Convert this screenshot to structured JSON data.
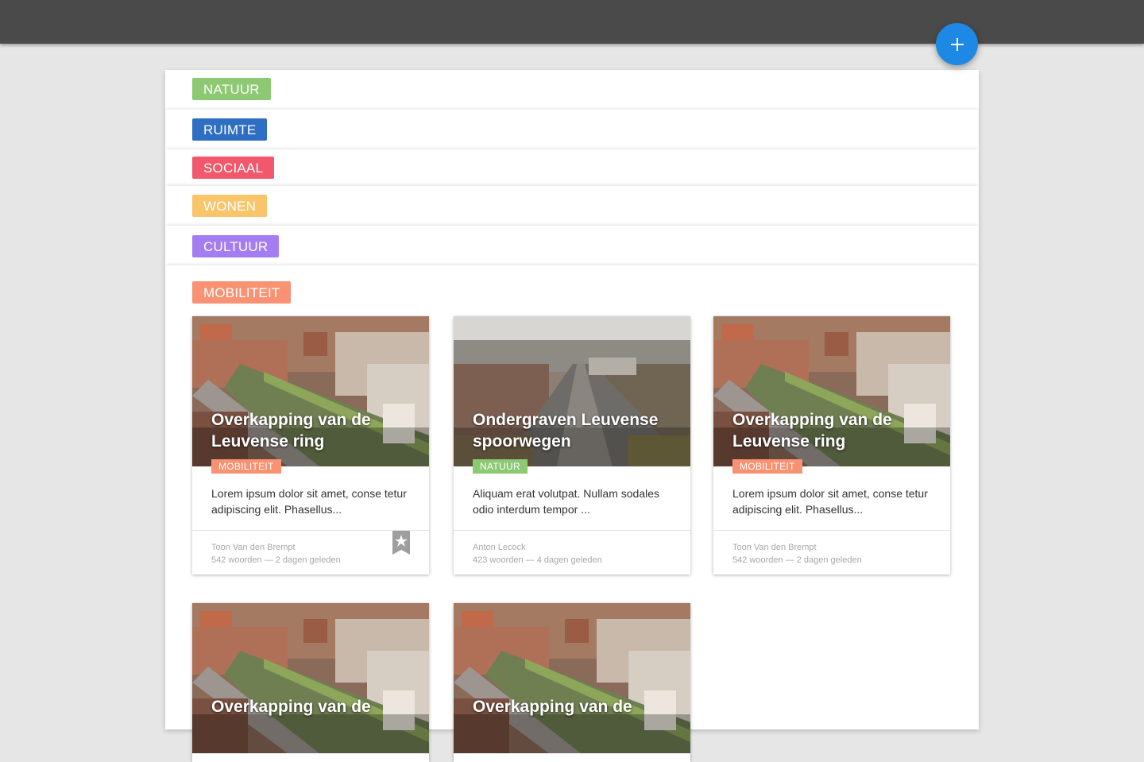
{
  "categories": [
    {
      "label": "NATUUR",
      "color": "#8cc972"
    },
    {
      "label": "RUIMTE",
      "color": "#2e6fc4"
    },
    {
      "label": "SOCIAAL",
      "color": "#f2586b"
    },
    {
      "label": "WONEN",
      "color": "#f8c56b"
    },
    {
      "label": "CULTUUR",
      "color": "#a57df2"
    },
    {
      "label": "MOBILITEIT",
      "color": "#f99272"
    }
  ],
  "cards": [
    {
      "title": "Overkapping van de Leuvense ring",
      "badge": "MOBILITEIT",
      "badge_color": "#f99272",
      "excerpt": "Lorem ipsum dolor sit amet, conse tetur adipiscing elit. Phasellus...",
      "author": "Toon Van den Brempt",
      "meta": "542 woorden — 2 dagen geleden",
      "bookmarked": true
    },
    {
      "title": "Ondergraven Leuvense spoorwegen",
      "badge": "NATUUR",
      "badge_color": "#8cc972",
      "excerpt": "Aliquam erat volutpat. Nullam sodales odio interdum tempor ...",
      "author": "Anton Lecock",
      "meta": "423 woorden — 4 dagen geleden",
      "bookmarked": false
    },
    {
      "title": "Overkapping van de Leuvense ring",
      "badge": "MOBILITEIT",
      "badge_color": "#f99272",
      "excerpt": "Lorem ipsum dolor sit amet, conse tetur adipiscing elit. Phasellus...",
      "author": "Toon Van den Brempt",
      "meta": "542 woorden — 2 dagen geleden",
      "bookmarked": false
    },
    {
      "title": "Overkapping van de",
      "partial": true
    },
    {
      "title": "Overkapping van de",
      "partial": true
    }
  ],
  "icons": {
    "fab": "plus-icon",
    "bookmark": "star-bookmark-icon"
  }
}
